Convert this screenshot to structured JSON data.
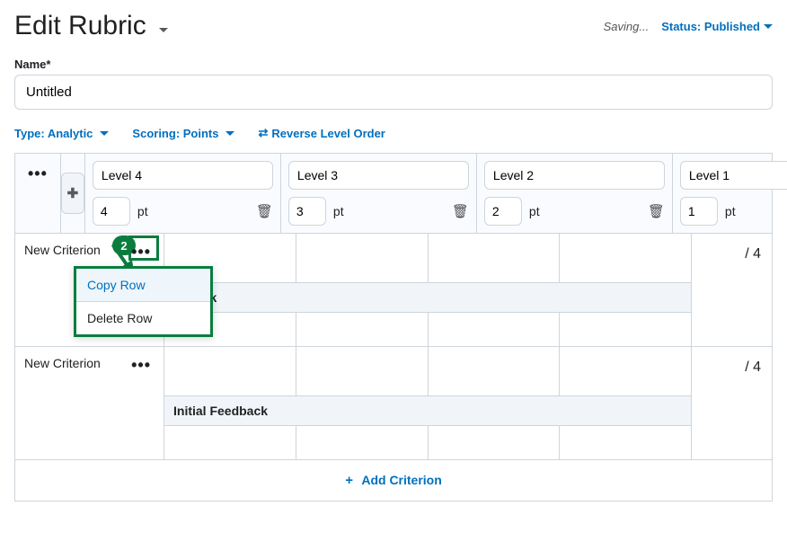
{
  "header": {
    "title": "Edit Rubric",
    "saving": "Saving...",
    "status": "Status: Published"
  },
  "name_field": {
    "label": "Name*",
    "value": "Untitled"
  },
  "options": {
    "type": "Type: Analytic",
    "scoring": "Scoring: Points",
    "reverse": "Reverse Level Order"
  },
  "levels": [
    {
      "name": "Level 4",
      "points": "4",
      "unit": "pt"
    },
    {
      "name": "Level 3",
      "points": "3",
      "unit": "pt"
    },
    {
      "name": "Level 2",
      "points": "2",
      "unit": "pt"
    },
    {
      "name": "Level 1",
      "points": "1",
      "unit": "pt"
    }
  ],
  "criteria": [
    {
      "name": "New Criterion",
      "feedback_label_visible": "edback",
      "score": "/ 4"
    },
    {
      "name": "New Criterion",
      "feedback_label": "Initial Feedback",
      "score": "/ 4"
    }
  ],
  "add_criterion": "Add Criterion",
  "row_menu": {
    "copy": "Copy Row",
    "delete": "Delete Row"
  },
  "annotation": {
    "badge": "2"
  }
}
